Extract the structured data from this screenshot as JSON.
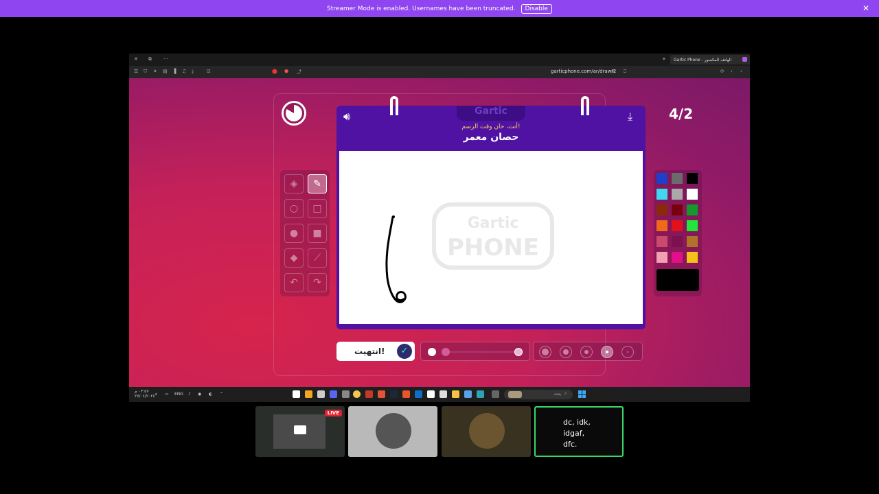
{
  "banner": {
    "message": "Streamer Mode is enabled. Usernames have been truncated.",
    "disable_label": "Disable",
    "close_icon": "✕"
  },
  "browser": {
    "tab_title": "Gartic Phone - الهاتف المكسور",
    "url": "garticphone.com/ar/draw/2",
    "controls": {
      "close": "✕",
      "restore": "⧉",
      "more": "···",
      "new_tab": "+"
    }
  },
  "game": {
    "logo": "Gartic",
    "prompt_subtitle": "أنت، حان وقت الرسم!",
    "prompt_word": "حصان معمر",
    "round_counter": "4/2",
    "done_label": "انتهيت!",
    "watermark_top": "Gartic",
    "watermark_bottom": "PHONE",
    "icons": {
      "volume": "volume-icon",
      "download": "download-icon",
      "timer": "timer-icon",
      "check": "check-icon"
    },
    "tools": [
      {
        "name": "eraser",
        "glyph": "◈",
        "active": false
      },
      {
        "name": "pencil",
        "glyph": "✎",
        "active": true
      },
      {
        "name": "ellipse-outline",
        "glyph": "○",
        "active": false
      },
      {
        "name": "rectangle-outline",
        "glyph": "□",
        "active": false
      },
      {
        "name": "ellipse-filled",
        "glyph": "●",
        "active": false
      },
      {
        "name": "rectangle-filled",
        "glyph": "■",
        "active": false
      },
      {
        "name": "fill-bucket",
        "glyph": "◆",
        "active": false
      },
      {
        "name": "line",
        "glyph": "⟋",
        "active": false
      },
      {
        "name": "undo",
        "glyph": "↶",
        "active": false
      },
      {
        "name": "redo",
        "glyph": "↷",
        "active": false
      }
    ],
    "palette": [
      "#1e3fc9",
      "#6b6b6b",
      "#000000",
      "#3fd8f0",
      "#a9a9a9",
      "#ffffff",
      "#8a2a0a",
      "#7a0010",
      "#149a2a",
      "#f06a1c",
      "#e2121c",
      "#22e63c",
      "#c94a6a",
      "#7d1050",
      "#b0722a",
      "#f0a0b0",
      "#e0108a",
      "#f5c21a"
    ],
    "current_color": "#000000"
  },
  "taskbar": {
    "time": "٠٣:٥٧ م",
    "date": "٢٧/٠٤/٢٠٢٤",
    "language": "ENG",
    "search_placeholder": "بحث"
  },
  "thumbnails": [
    {
      "label": "LIVE"
    },
    {
      "label": ""
    },
    {
      "label": ""
    },
    {
      "text": "dc,  idk,\nidgaf,\ndfc."
    }
  ]
}
